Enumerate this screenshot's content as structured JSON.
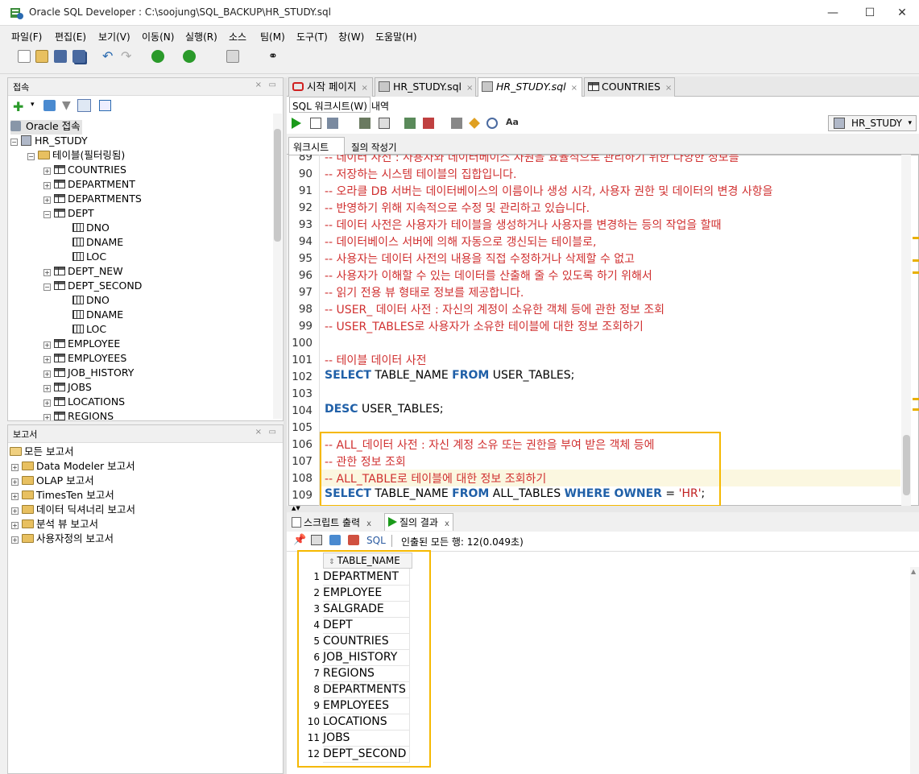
{
  "window": {
    "title": "Oracle SQL Developer : C:\\soojung\\SQL_BACKUP\\HR_STUDY.sql",
    "minimize": "—",
    "maximize": "☐",
    "close": "✕"
  },
  "menu": [
    "파일(F)",
    "편집(E)",
    "보기(V)",
    "이동(N)",
    "실행(R)",
    "소스",
    "팀(M)",
    "도구(T)",
    "창(W)",
    "도움말(H)"
  ],
  "connections_panel": {
    "title": "접속",
    "root": "Oracle 접속",
    "connection": "HR_STUDY",
    "tables_folder": "테이블(필터링됨)",
    "tables": [
      {
        "label": "COUNTRIES",
        "expanded": false
      },
      {
        "label": "DEPARTMENT",
        "expanded": false
      },
      {
        "label": "DEPARTMENTS",
        "expanded": false
      },
      {
        "label": "DEPT",
        "expanded": true,
        "columns": [
          "DNO",
          "DNAME",
          "LOC"
        ]
      },
      {
        "label": "DEPT_NEW",
        "expanded": false
      },
      {
        "label": "DEPT_SECOND",
        "expanded": true,
        "columns": [
          "DNO",
          "DNAME",
          "LOC"
        ]
      },
      {
        "label": "EMPLOYEE",
        "expanded": false
      },
      {
        "label": "EMPLOYEES",
        "expanded": false
      },
      {
        "label": "JOB_HISTORY",
        "expanded": false
      },
      {
        "label": "JOBS",
        "expanded": false
      },
      {
        "label": "LOCATIONS",
        "expanded": false
      },
      {
        "label": "REGIONS",
        "expanded": false
      }
    ]
  },
  "reports_panel": {
    "title": "보고서",
    "root": "모든 보고서",
    "items": [
      "Data Modeler 보고서",
      "OLAP 보고서",
      "TimesTen 보고서",
      "데이터 딕셔너리 보고서",
      "분석 뷰 보고서",
      "사용자정의 보고서"
    ]
  },
  "editor_tabs": [
    {
      "label": "시작 페이지",
      "active": false
    },
    {
      "label": "HR_STUDY.sql",
      "active": false
    },
    {
      "label": "HR_STUDY.sql",
      "active": true
    },
    {
      "label": "COUNTRIES",
      "active": false
    }
  ],
  "subtabs": {
    "worksheet": "SQL 워크시트(W)",
    "history": "내역"
  },
  "connection_selector": "HR_STUDY",
  "worksheet_tabs": {
    "worksheet": "워크시트",
    "query_builder": "질의 작성기"
  },
  "code_lines": [
    {
      "n": "89",
      "text": "-- 데이터 사전 : 사용자와 데이터베이스 자원을 효율적으로 관리하기 위한 다양한 정보를"
    },
    {
      "n": "90",
      "text": "-- 저장하는 시스템 테이블의 집합입니다."
    },
    {
      "n": "91",
      "text": "-- 오라클 DB 서버는 데이터베이스의 이름이나 생성 시각, 사용자 권한 및 데이터의 변경 사항을"
    },
    {
      "n": "92",
      "text": "-- 반영하기 위해 지속적으로 수정 및 관리하고 있습니다."
    },
    {
      "n": "93",
      "text": "-- 데이터 사전은 사용자가 테이블을 생성하거나 사용자를 변경하는 등의 작업을 할때"
    },
    {
      "n": "94",
      "text": "-- 데이터베이스 서버에 의해 자동으로 갱신되는 테이블로,"
    },
    {
      "n": "95",
      "text": "-- 사용자는 데이터 사전의 내용을 직접 수정하거나 삭제할 수 없고"
    },
    {
      "n": "96",
      "text": "-- 사용자가 이해할 수 있는 데이터를 산출해 줄 수 있도록 하기 위해서"
    },
    {
      "n": "97",
      "text": "-- 읽기 전용 뷰 형태로 정보를 제공합니다."
    },
    {
      "n": "98",
      "text": "-- USER_ 데이터 사전 : 자신의 계정이 소유한 객체 등에 관한 정보 조회"
    },
    {
      "n": "99",
      "text": "-- USER_TABLES로 사용자가 소유한 테이블에 대한 정보 조회하기"
    },
    {
      "n": "100",
      "text": ""
    },
    {
      "n": "101",
      "text": "-- 테이블 데이터 사전"
    },
    {
      "n": "102",
      "kw1": "SELECT",
      "p1": " TABLE_NAME ",
      "kw2": "FROM",
      "p2": " USER_TABLES;"
    },
    {
      "n": "103",
      "text": ""
    },
    {
      "n": "104",
      "kw1": "DESC",
      "p1": " USER_TABLES;"
    },
    {
      "n": "105",
      "text": ""
    },
    {
      "n": "106",
      "text": "-- ALL_데이터 사전 : 자신 계정 소유 또는 권한을 부여 받은 객체 등에"
    },
    {
      "n": "107",
      "text": "-- 관한 정보 조회"
    },
    {
      "n": "108",
      "text": "-- ALL_TABLE로 테이블에 대한 정보 조회하기"
    },
    {
      "n": "109",
      "kw1": "SELECT",
      "p1": " TABLE_NAME ",
      "kw2": "FROM",
      "p2": " ALL_TABLES ",
      "kw3": "WHERE",
      "kw4": " OWNER",
      "p3": " = ",
      "str": "'HR'",
      "p4": ";"
    }
  ],
  "output_tabs": {
    "script_output": "스크립트 출력",
    "query_result": "질의 결과"
  },
  "result_toolbar": {
    "sql": "SQL",
    "status": "인출된 모든 행: 12(0.049초)"
  },
  "result": {
    "column": "TABLE_NAME",
    "rows": [
      "DEPARTMENT",
      "EMPLOYEE",
      "SALGRADE",
      "DEPT",
      "COUNTRIES",
      "JOB_HISTORY",
      "REGIONS",
      "DEPARTMENTS",
      "EMPLOYEES",
      "LOCATIONS",
      "JOBS",
      "DEPT_SECOND"
    ]
  },
  "colors": {
    "highlight_box": "#f5b800",
    "comment": "#d03030",
    "keyword": "#2060a8"
  }
}
